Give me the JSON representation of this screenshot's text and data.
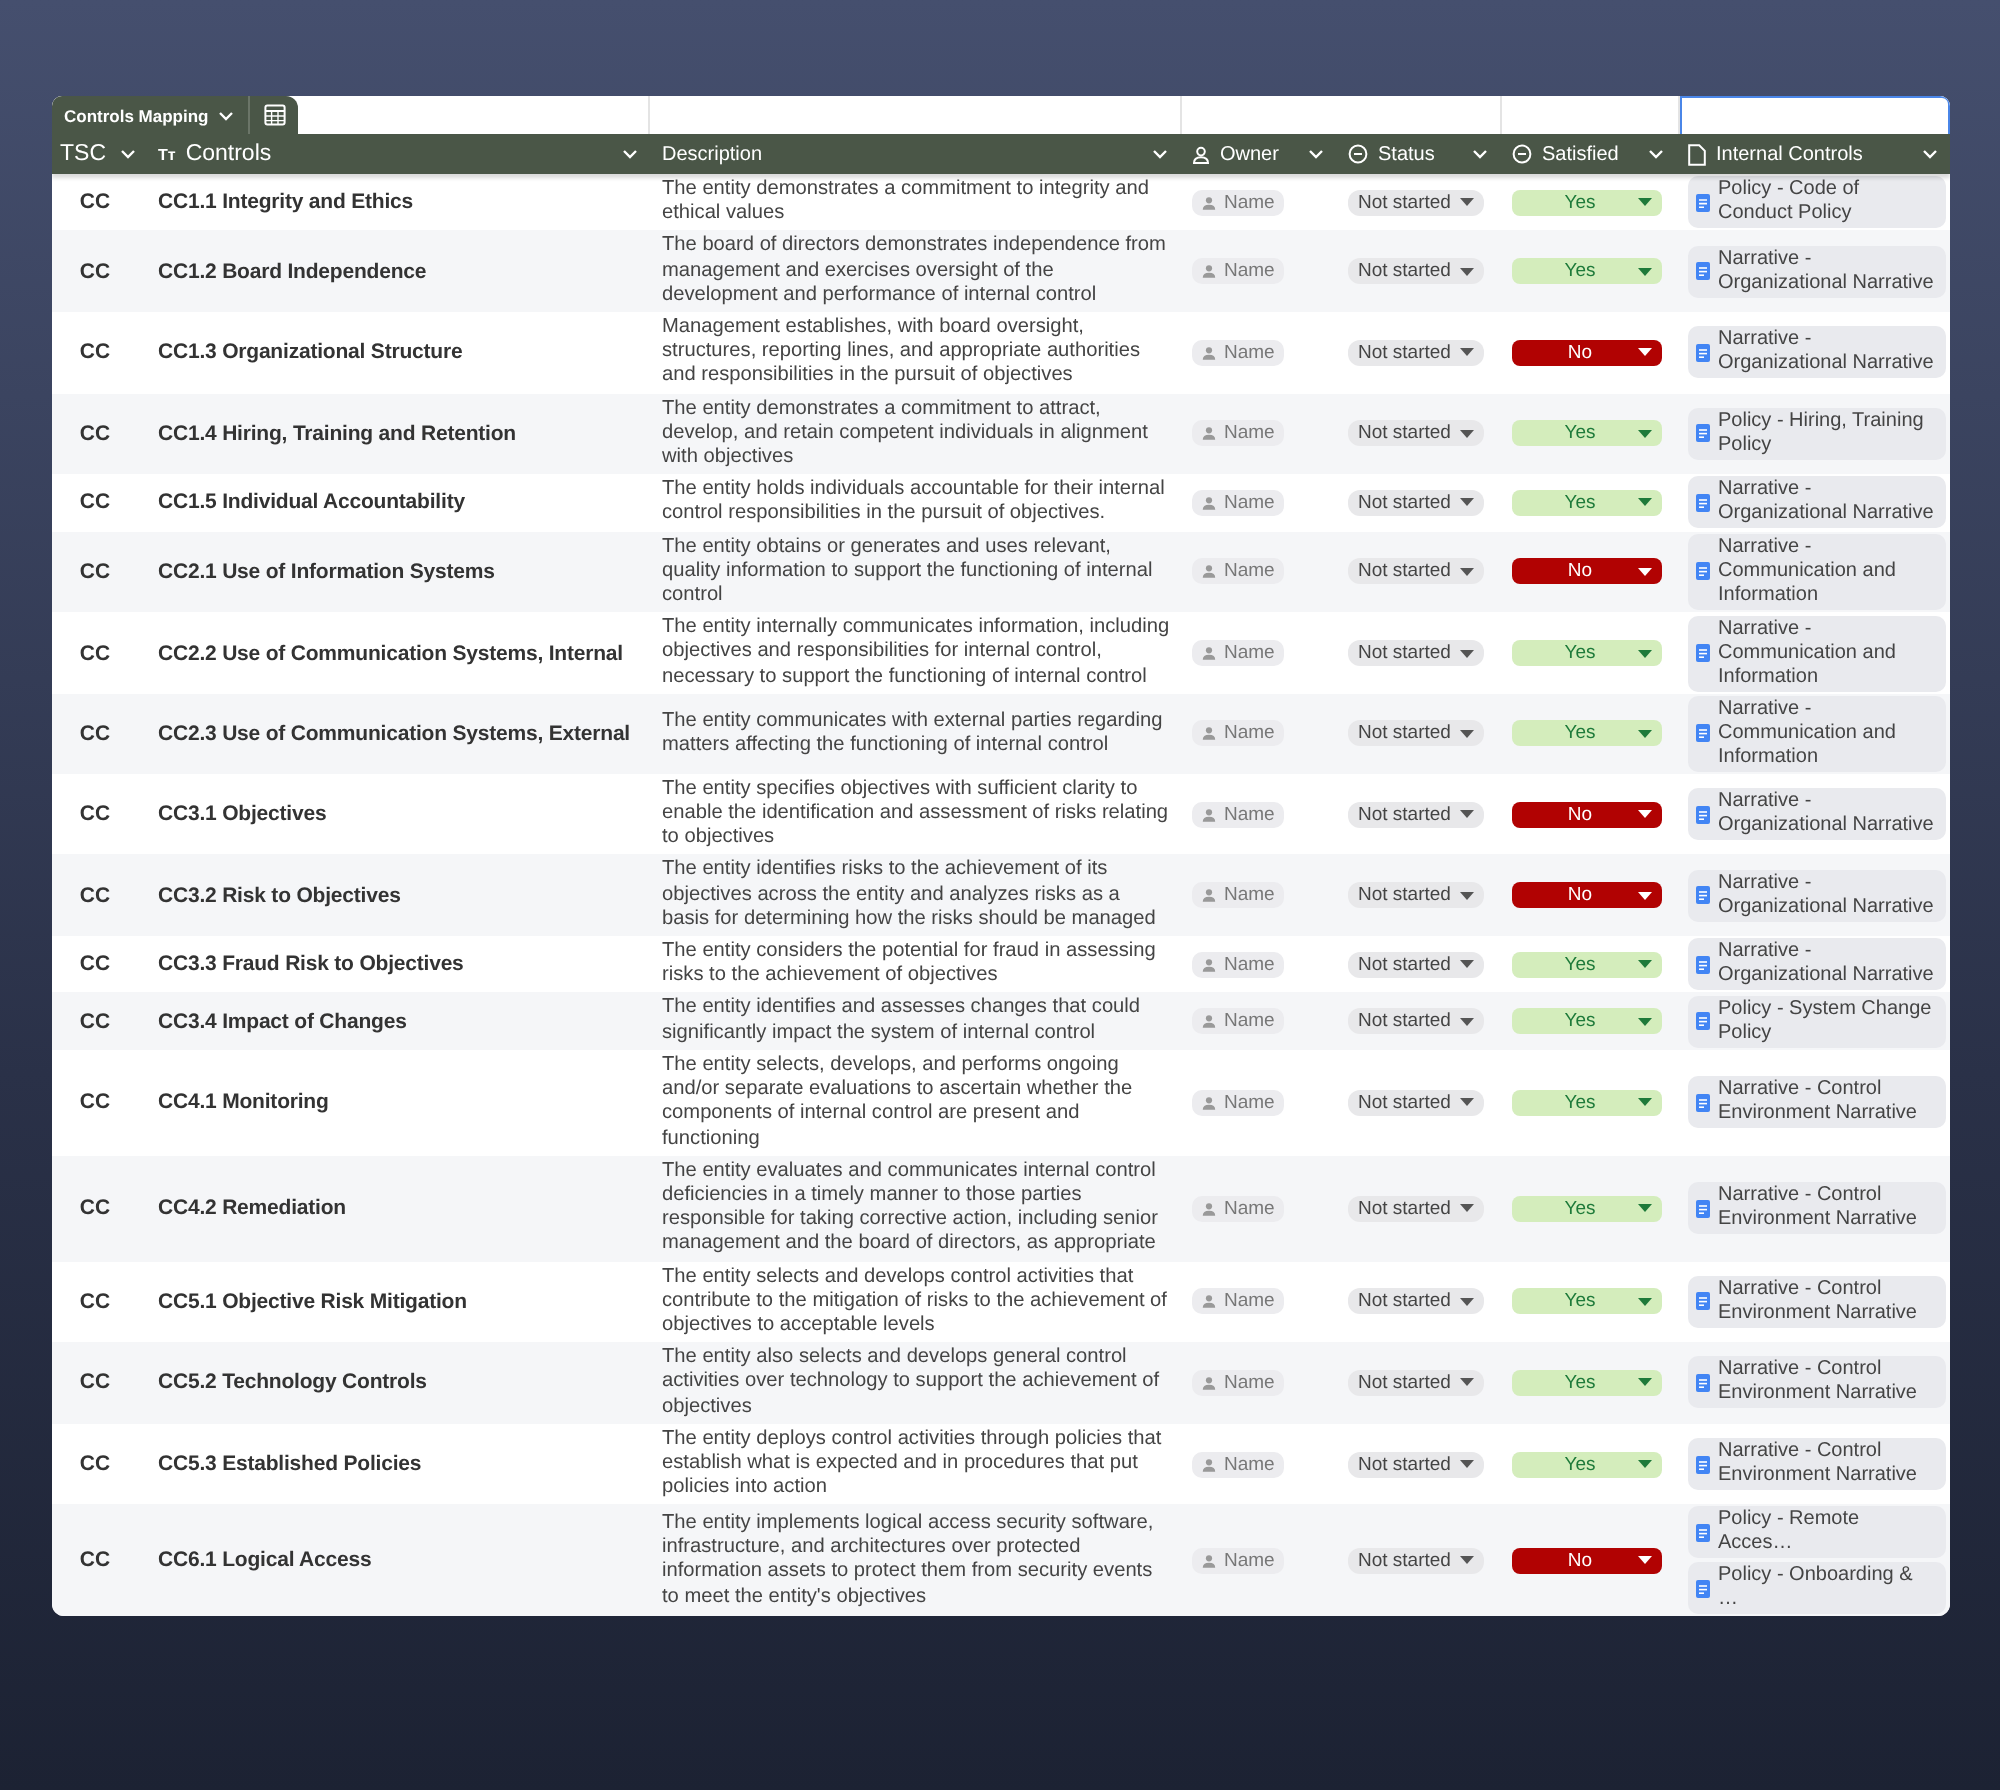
{
  "tab": {
    "label": "Controls Mapping"
  },
  "columns": [
    {
      "label": "TSC",
      "kind": "plain"
    },
    {
      "label": "Controls",
      "kind": "text",
      "icon_text": "Tт"
    },
    {
      "label": "Description",
      "kind": "plain"
    },
    {
      "label": "Owner",
      "kind": "person"
    },
    {
      "label": "Status",
      "kind": "status"
    },
    {
      "label": "Satisfied",
      "kind": "status"
    },
    {
      "label": "Internal Controls",
      "kind": "doc"
    }
  ],
  "rows": [
    {
      "tsc": "CC",
      "control": "CC1.1 Integrity and Ethics",
      "description": "The entity demonstrates a commitment to integrity and ethical values",
      "owner": "Name",
      "status": "Not started",
      "satisfied": {
        "label": "Yes",
        "positive": true
      },
      "internal_controls": [
        "Policy - Code of Conduct Policy"
      ]
    },
    {
      "tsc": "CC",
      "control": "CC1.2 Board Independence",
      "description": "The board of directors demonstrates independence from management and exercises oversight of the development and performance of internal control",
      "owner": "Name",
      "status": "Not started",
      "satisfied": {
        "label": "Yes",
        "positive": true
      },
      "internal_controls": [
        "Narrative - Organizational Narrative"
      ]
    },
    {
      "tsc": "CC",
      "control": "CC1.3 Organizational Structure",
      "description": "Management establishes, with board oversight, structures, reporting lines, and appropriate authorities and responsibilities in the pursuit of objectives",
      "owner": "Name",
      "status": "Not started",
      "satisfied": {
        "label": "No",
        "positive": false
      },
      "internal_controls": [
        "Narrative - Organizational Narrative"
      ]
    },
    {
      "tsc": "CC",
      "control": "CC1.4 Hiring, Training and Retention",
      "description": "The entity demonstrates a commitment to attract, develop, and retain competent individuals in alignment with objectives",
      "owner": "Name",
      "status": "Not started",
      "satisfied": {
        "label": "Yes",
        "positive": true
      },
      "internal_controls": [
        "Policy - Hiring, Training Policy"
      ]
    },
    {
      "tsc": "CC",
      "control": "CC1.5 Individual Accountability",
      "description": "The entity holds individuals accountable for their internal control responsibilities in the pursuit of objectives.",
      "owner": "Name",
      "status": "Not started",
      "satisfied": {
        "label": "Yes",
        "positive": true
      },
      "internal_controls": [
        "Narrative - Organizational Narrative"
      ]
    },
    {
      "tsc": "CC",
      "control": "CC2.1 Use of Information Systems",
      "description": "The entity obtains or generates and uses relevant, quality information to support the functioning of internal control",
      "owner": "Name",
      "status": "Not started",
      "satisfied": {
        "label": "No",
        "positive": false
      },
      "internal_controls": [
        "Narrative - Communication and Information"
      ]
    },
    {
      "tsc": "CC",
      "control": "CC2.2 Use of Communication Systems, Internal",
      "description": "The entity internally communicates information, including objectives and responsibilities for internal control, necessary to support the functioning of internal control",
      "owner": "Name",
      "status": "Not started",
      "satisfied": {
        "label": "Yes",
        "positive": true
      },
      "internal_controls": [
        "Narrative - Communication and Information"
      ]
    },
    {
      "tsc": "CC",
      "control": "CC2.3 Use of Communication Systems, External",
      "description": "The entity communicates with external parties regarding matters affecting the functioning of internal control",
      "owner": "Name",
      "status": "Not started",
      "satisfied": {
        "label": "Yes",
        "positive": true
      },
      "internal_controls": [
        "Narrative - Communication and Information"
      ]
    },
    {
      "tsc": "CC",
      "control": "CC3.1 Objectives",
      "description": "The entity specifies objectives with sufficient clarity to enable the identification and assessment of risks relating to objectives",
      "owner": "Name",
      "status": "Not started",
      "satisfied": {
        "label": "No",
        "positive": false
      },
      "internal_controls": [
        "Narrative - Organizational Narrative"
      ]
    },
    {
      "tsc": "CC",
      "control": "CC3.2 Risk to Objectives",
      "description": "The entity identifies risks to the achievement of its objectives across the entity and analyzes risks as a basis for determining how the risks should be managed",
      "owner": "Name",
      "status": "Not started",
      "satisfied": {
        "label": "No",
        "positive": false
      },
      "internal_controls": [
        "Narrative - Organizational Narrative"
      ]
    },
    {
      "tsc": "CC",
      "control": "CC3.3 Fraud Risk to Objectives",
      "description": "The entity considers the potential for fraud in assessing risks to the achievement of objectives",
      "owner": "Name",
      "status": "Not started",
      "satisfied": {
        "label": "Yes",
        "positive": true
      },
      "internal_controls": [
        "Narrative - Organizational Narrative"
      ]
    },
    {
      "tsc": "CC",
      "control": "CC3.4 Impact of Changes",
      "description": "The entity identifies and assesses changes that could significantly impact the system of internal control",
      "owner": "Name",
      "status": "Not started",
      "satisfied": {
        "label": "Yes",
        "positive": true
      },
      "internal_controls": [
        "Policy - System Change Policy"
      ]
    },
    {
      "tsc": "CC",
      "control": "CC4.1 Monitoring",
      "description": "The entity selects, develops, and performs ongoing and/or separate evaluations to ascertain whether the components of internal control are present and functioning",
      "owner": "Name",
      "status": "Not started",
      "satisfied": {
        "label": "Yes",
        "positive": true
      },
      "internal_controls": [
        "Narrative - Control Environment Narrative"
      ]
    },
    {
      "tsc": "CC",
      "control": "CC4.2 Remediation",
      "description": "The entity evaluates and communicates internal control deficiencies in a timely manner to those parties responsible for taking corrective action, including senior management and the board of directors, as appropriate",
      "owner": "Name",
      "status": "Not started",
      "satisfied": {
        "label": "Yes",
        "positive": true
      },
      "internal_controls": [
        "Narrative - Control Environment Narrative"
      ]
    },
    {
      "tsc": "CC",
      "control": "CC5.1 Objective Risk Mitigation",
      "description": "The entity selects and develops control activities that contribute to the mitigation of risks to the achievement of objectives to acceptable levels",
      "owner": "Name",
      "status": "Not started",
      "satisfied": {
        "label": "Yes",
        "positive": true
      },
      "internal_controls": [
        "Narrative - Control Environment Narrative"
      ]
    },
    {
      "tsc": "CC",
      "control": "CC5.2 Technology Controls",
      "description": "The entity also selects and develops general control activities over technology to support the achievement of objectives",
      "owner": "Name",
      "status": "Not started",
      "satisfied": {
        "label": "Yes",
        "positive": true
      },
      "internal_controls": [
        "Narrative - Control Environment Narrative"
      ]
    },
    {
      "tsc": "CC",
      "control": "CC5.3 Established Policies",
      "description": "The entity deploys control activities through policies that establish what is expected and in procedures that put policies into action",
      "owner": "Name",
      "status": "Not started",
      "satisfied": {
        "label": "Yes",
        "positive": true
      },
      "internal_controls": [
        "Narrative - Control Environment Narrative"
      ]
    },
    {
      "tsc": "CC",
      "control": "CC6.1 Logical Access",
      "description": "The entity implements logical access security software, infrastructure, and architectures over protected information assets to protect them from security events to meet the entity's objectives",
      "owner": "Name",
      "status": "Not started",
      "satisfied": {
        "label": "No",
        "positive": false
      },
      "internal_controls": [
        "Policy - Remote Acces…",
        "Policy - Onboarding & …"
      ]
    }
  ]
}
